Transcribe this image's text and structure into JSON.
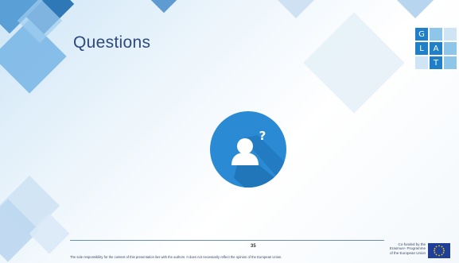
{
  "slide": {
    "title": "Questions",
    "page_number": "35",
    "disclaimer": "The sole responsibility for the content of this presentation lies with the authors. It does not necessarily reflect the opinion of the European Union.",
    "logo_letters": [
      "G",
      "L",
      "A",
      "T"
    ],
    "eu_credit": [
      "Co-funded by the",
      "Erasmus+ Programme",
      "of the European Union"
    ]
  },
  "icons": {
    "main": "user-question-icon",
    "flag": "eu-flag-icon"
  },
  "colors": {
    "title": "#2d4a7c",
    "accent": "#2a8ad4",
    "logo_dark": "#1f7fc8",
    "logo_light": "#8ec6ea"
  }
}
